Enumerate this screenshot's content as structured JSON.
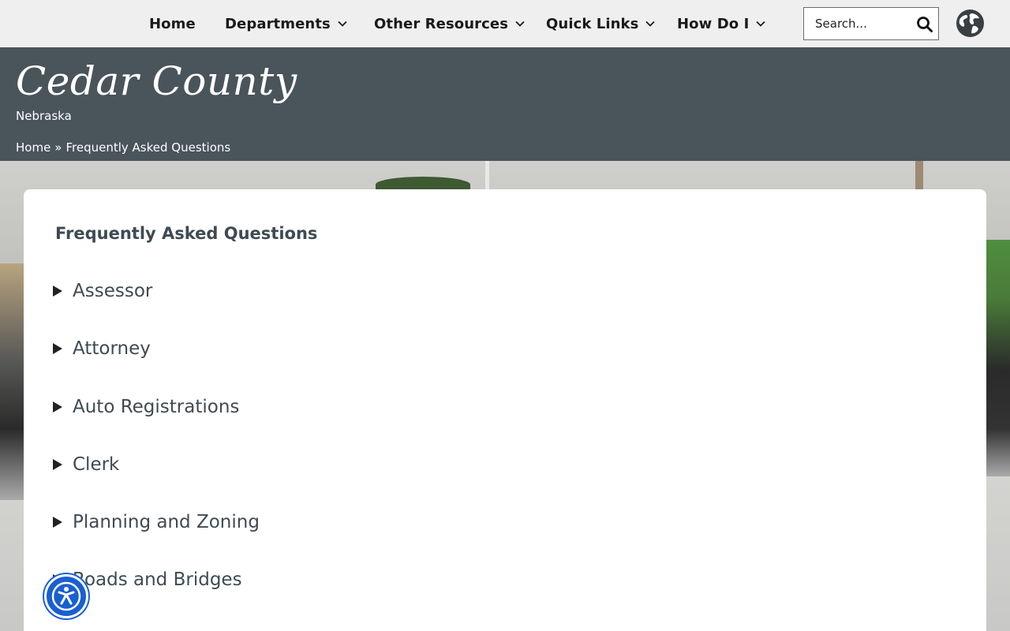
{
  "nav": {
    "items": [
      {
        "label": "Home",
        "has_dropdown": false
      },
      {
        "label": "Departments",
        "has_dropdown": true
      },
      {
        "label": "Other Resources",
        "has_dropdown": true
      },
      {
        "label": "Quick Links",
        "has_dropdown": true
      },
      {
        "label": "How Do I",
        "has_dropdown": true
      }
    ],
    "search_placeholder": "Search...",
    "search_icon": "search-icon",
    "language_icon": "globe-icon"
  },
  "header": {
    "title": "Cedar County",
    "subtitle": "Nebraska",
    "breadcrumb": {
      "home": "Home",
      "separator": "»",
      "current": "Frequently Asked Questions"
    }
  },
  "main": {
    "heading": "Frequently Asked Questions",
    "faq_items": [
      "Assessor",
      "Attorney",
      "Auto Registrations",
      "Clerk",
      "Planning and Zoning",
      "Roads and Bridges"
    ]
  },
  "accessibility": {
    "icon": "accessibility-icon"
  },
  "colors": {
    "header_bg": "#4a545b",
    "nav_bg": "#efefef",
    "text_dark": "#3f4a52",
    "a11y_blue": "#1a5fd1"
  }
}
